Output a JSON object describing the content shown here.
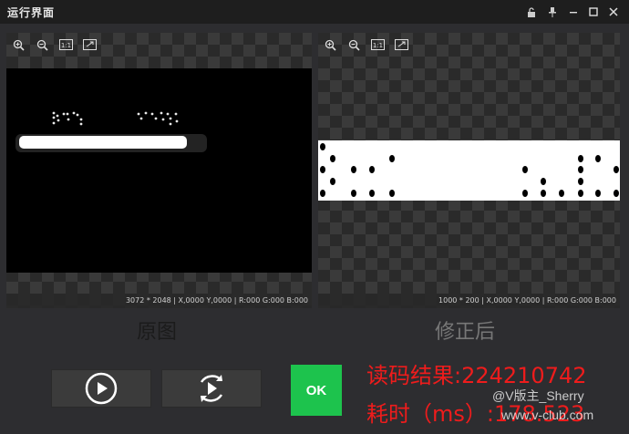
{
  "window": {
    "title": "运行界面",
    "controls": [
      "lock-icon",
      "pin-icon",
      "minimize-icon",
      "maximize-icon",
      "close-icon"
    ]
  },
  "left_viewer": {
    "tools": [
      "zoom-in-icon",
      "zoom-out-icon",
      "actual-size-icon",
      "fit-icon"
    ],
    "tool_labels": {
      "actual_size": "1:1"
    },
    "status": "3072 * 2048  |  X,0000  Y,0000  |  R:000  G:000  B:000",
    "caption": "原图"
  },
  "right_viewer": {
    "tools": [
      "zoom-in-icon",
      "zoom-out-icon",
      "actual-size-icon",
      "fit-icon"
    ],
    "tool_labels": {
      "actual_size": "1:1"
    },
    "status": "1000 * 200  |  X,0000  Y,0000  |  R:000  G:000  B:000",
    "caption": "修正后"
  },
  "buttons": {
    "play": "play-icon",
    "loop": "loop-play-icon",
    "ok_label": "OK"
  },
  "result": {
    "code_line": "读码结果:224210742",
    "time_line": "耗时（ms）:178.523"
  },
  "watermark": {
    "line1": "@V版主_Sherry",
    "line2": "www.v-club.com"
  },
  "colors": {
    "ok_green": "#1dc34d",
    "result_red": "#ee1c1c",
    "background": "#2d2d30"
  }
}
